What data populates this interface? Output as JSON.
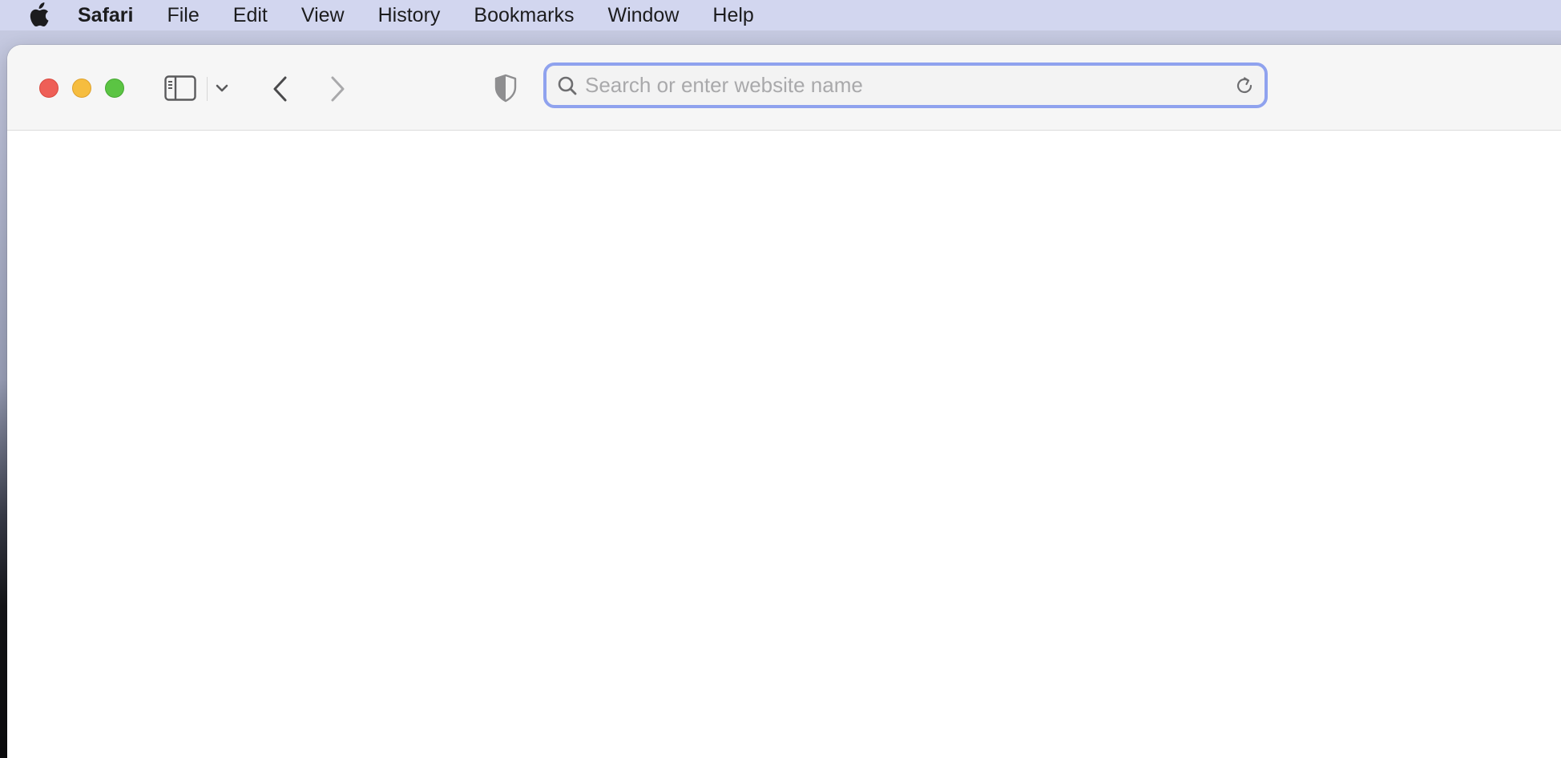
{
  "menubar": {
    "apple_icon": "apple-logo-icon",
    "items": [
      {
        "label": "Safari",
        "bold": true
      },
      {
        "label": "File"
      },
      {
        "label": "Edit"
      },
      {
        "label": "View"
      },
      {
        "label": "History"
      },
      {
        "label": "Bookmarks"
      },
      {
        "label": "Window"
      },
      {
        "label": "Help"
      }
    ]
  },
  "window": {
    "traffic_lights": {
      "close_color": "#ee5f57",
      "minimize_color": "#f6bd3f",
      "zoom_color": "#5bc443"
    },
    "toolbar": {
      "icons": [
        "sidebar-icon",
        "chevron-down-icon",
        "chevron-left-icon",
        "chevron-right-icon",
        "shield-icon"
      ],
      "address_bar": {
        "placeholder": "Search or enter website name",
        "value": "",
        "focus_ring_color": "#8fa2ee",
        "icons": [
          "search-icon",
          "reload-icon"
        ]
      }
    }
  }
}
